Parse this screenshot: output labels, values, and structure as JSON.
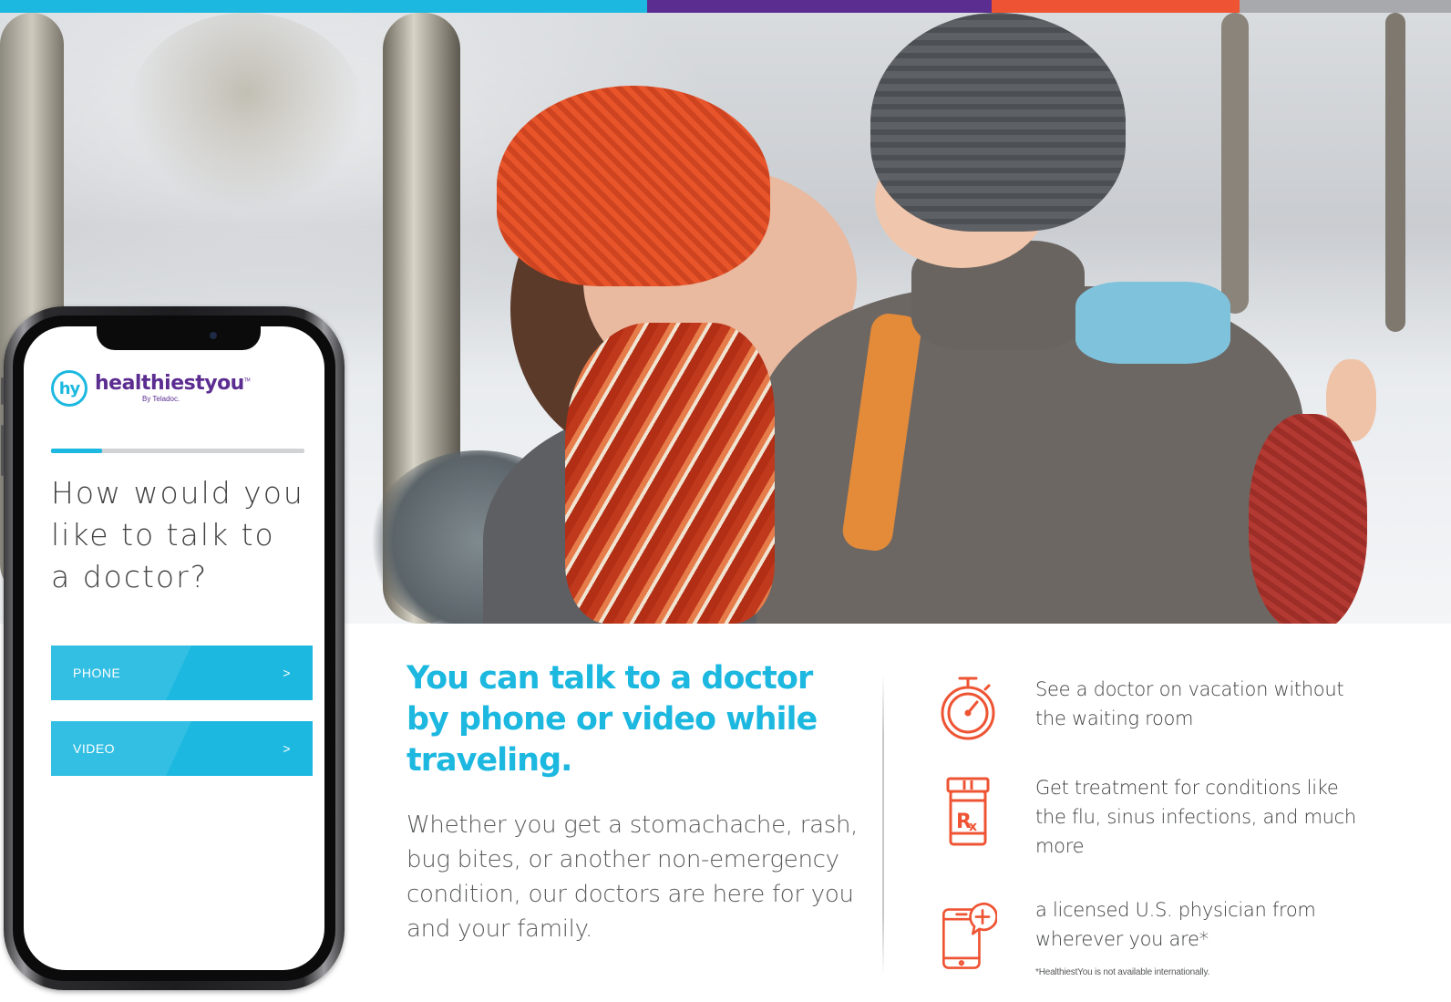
{
  "colors": {
    "strip": [
      "#1cb8e0",
      "#5c2d91",
      "#ee5433",
      "#a7a9ac"
    ],
    "accent": "#1cb8e0",
    "brand_purple": "#5c2d91",
    "icon_orange": "#ee5433"
  },
  "phone_app": {
    "logo_mark": "hy",
    "logo_name": "healthiestyou",
    "logo_tm": "TM",
    "logo_by": "By Teladoc.",
    "progress_fraction": 0.2,
    "question": "How would you like to talk to a doctor?",
    "options": [
      {
        "label": "PHONE",
        "chevron": ">"
      },
      {
        "label": "VIDEO",
        "chevron": ">"
      }
    ]
  },
  "headline": "You can talk to a doctor by phone or video while traveling.",
  "body": "Whether you get a stomachache, rash, bug bites, or another non-emergency condition, our doctors are here for you and your family.",
  "features": [
    {
      "icon": "stopwatch-icon",
      "text": "See a doctor on vacation without the waiting room"
    },
    {
      "icon": "rx-bottle-icon",
      "text": "Get treatment for conditions like the flu, sinus infections, and much more"
    },
    {
      "icon": "phone-plus-icon",
      "text": "a licensed U.S. physician from wherever you are*"
    }
  ],
  "footnote": "*HealthiestYou is not available internationally."
}
